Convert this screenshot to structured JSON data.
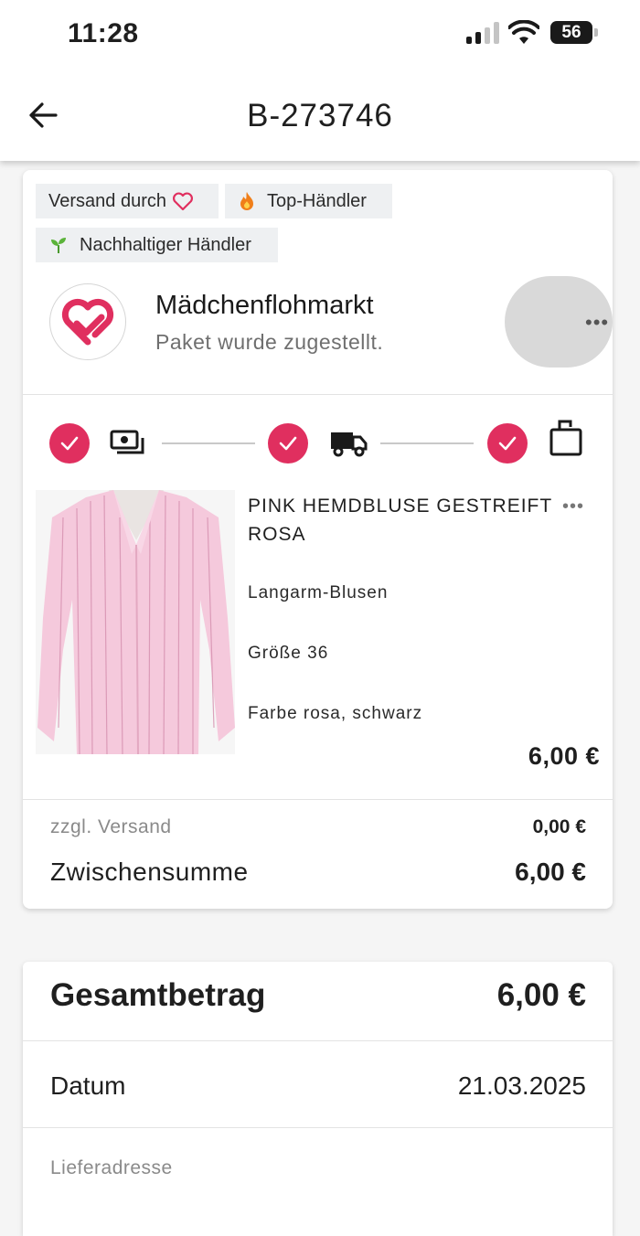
{
  "status_bar": {
    "time": "11:28",
    "battery": "56"
  },
  "header": {
    "title": "B-273746"
  },
  "badges": {
    "shipping_by": "Versand durch",
    "top_seller": "Top-Händler",
    "sustainable": "Nachhaltiger Händler"
  },
  "seller": {
    "name": "Mädchenflohmarkt",
    "status": "Paket wurde zugestellt."
  },
  "progress": {
    "steps": [
      "payment",
      "shipping",
      "delivered"
    ],
    "completed": 3
  },
  "product": {
    "title": "PINK HEMDBLUSE GESTREIFT ROSA",
    "category": "Langarm-Blusen",
    "size": "Größe 36",
    "color": "Farbe rosa, schwarz",
    "price": "6,00 €"
  },
  "summary": {
    "shipping_label": "zzgl. Versand",
    "shipping_value": "0,00 €",
    "subtotal_label": "Zwischensumme",
    "subtotal_value": "6,00 €"
  },
  "totals": {
    "total_label": "Gesamtbetrag",
    "total_value": "6,00 €",
    "date_label": "Datum",
    "date_value": "21.03.2025",
    "address_label": "Lieferadresse"
  },
  "colors": {
    "accent": "#e02f5f",
    "badge_bg": "#eef0f2"
  }
}
